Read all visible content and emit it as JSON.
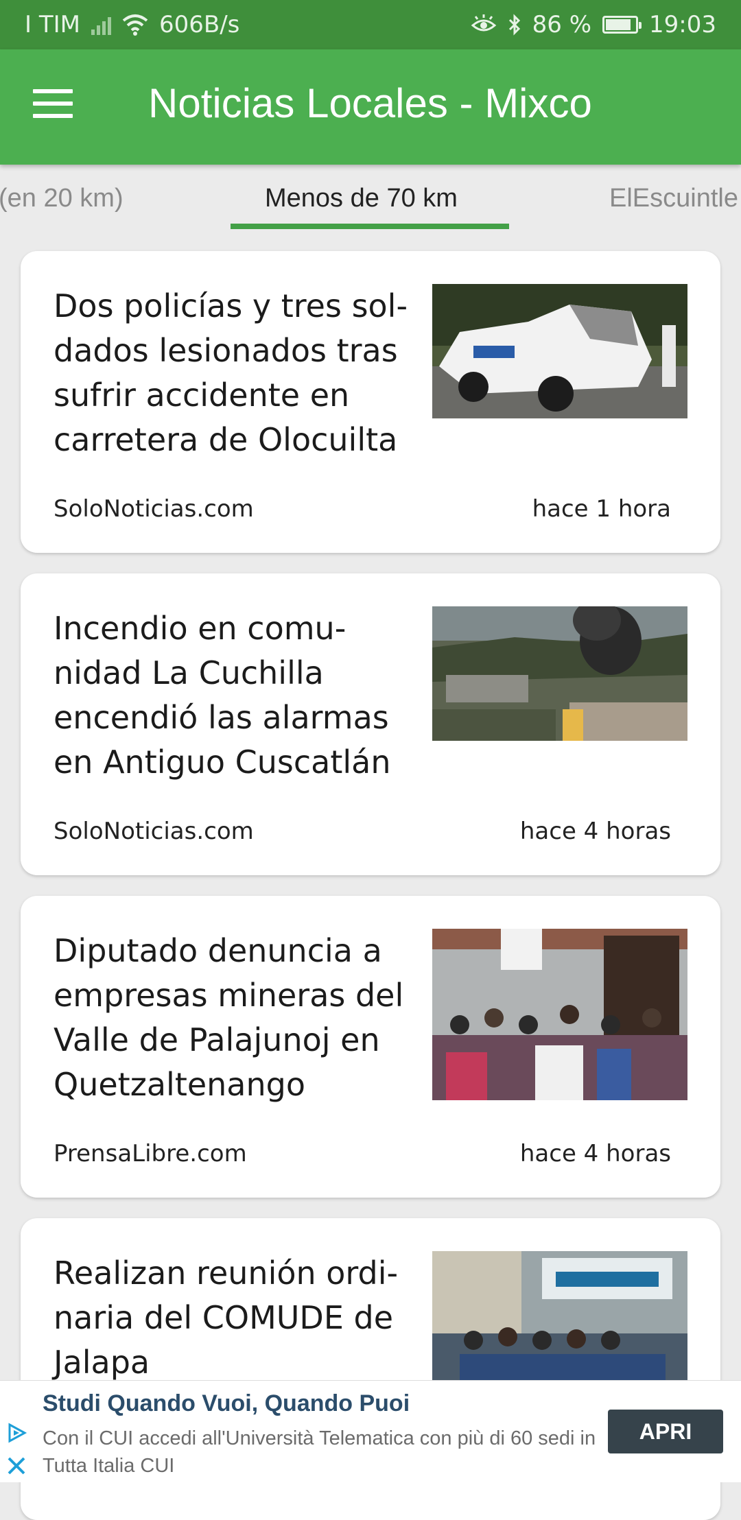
{
  "status_bar": {
    "carrier": "I TIM",
    "net_speed": "606B/s",
    "battery": "86 %",
    "battery_level": 0.86,
    "time": "19:03",
    "icons": [
      "signal-icon",
      "wifi-icon",
      "eye-comfort-icon",
      "bluetooth-icon",
      "battery-icon"
    ]
  },
  "app_bar": {
    "title": "Noticias Locales - Mixco",
    "menu_icon": "hamburger-menu-icon",
    "background": "#4caf50"
  },
  "tabs": {
    "items": [
      {
        "label": "(en 20 km)",
        "active": false
      },
      {
        "label": "Menos de 70 km",
        "active": true
      },
      {
        "label": "ElEscuintle",
        "active": false
      }
    ],
    "indicator_color": "#43a047"
  },
  "articles": [
    {
      "title": "Dos policías y tres sol-dados lesionados tras sufrir accidente en carretera de Olocuilta",
      "title_lines": [
        "Dos policías y tres sol-",
        "dados lesionados tras",
        "sufrir accidente en",
        "carretera de Olocuilta"
      ],
      "source": "SoloNoticias.com",
      "time": "hace 1 hora",
      "image": "crashed-police-pickup-photo"
    },
    {
      "title": "Incendio en comu-nidad La Cuchilla encendió las alarmas en Antiguo Cuscatlán",
      "title_lines": [
        "Incendio en comu-",
        "nidad La Cuchilla",
        "encendió las alarmas",
        "en Antiguo Cuscatlán"
      ],
      "source": "SoloNoticias.com",
      "time": "hace 4 horas",
      "image": "fire-smoke-city-photo"
    },
    {
      "title": "Diputado denuncia a empresas mineras del Valle de Palajunoj en Quetzaltenango",
      "title_lines": [
        "Diputado denuncia a",
        "empresas mineras del",
        "Valle de Palajunoj en",
        "Quetzaltenango"
      ],
      "source": "PrensaLibre.com",
      "time": "hace 4 horas",
      "image": "crowd-at-mp-office-photo"
    },
    {
      "title": "Realizan reunión ordi-naria del COMUDE de Jalapa",
      "title_lines": [
        "Realizan reunión ordi-",
        "naria del COMUDE de",
        "Jalapa"
      ],
      "source": "",
      "time": "",
      "image": "comude-meeting-photo"
    }
  ],
  "ad": {
    "headline": "Studi Quando Vuoi, Quando Puoi",
    "body": "Con il CUI accedi all'Università Telematica con più di 60 sedi in Tutta Italia",
    "brand": "CUI",
    "cta": "APRI",
    "headline_color": "#2b4d6b",
    "cta_color": "#36434b"
  }
}
